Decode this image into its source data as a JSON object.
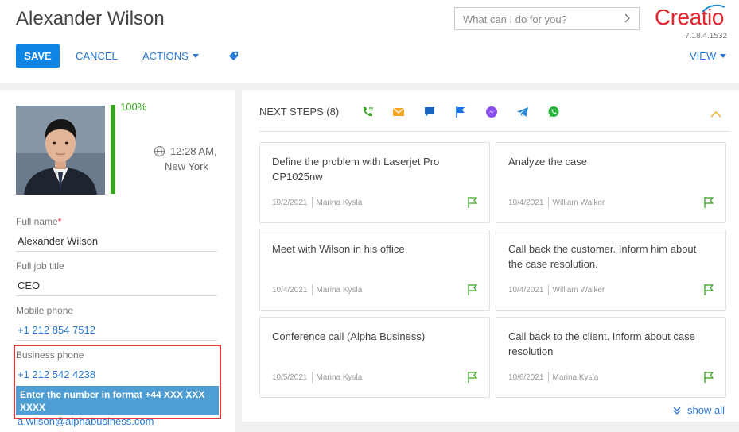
{
  "header": {
    "title": "Alexander Wilson",
    "search_placeholder": "What can I do for you?",
    "logo": "Creatio",
    "version": "7.18.4.1532",
    "save_label": "SAVE",
    "cancel_label": "CANCEL",
    "actions_label": "ACTIONS",
    "view_label": "VIEW"
  },
  "profile": {
    "completeness": "100%",
    "completeness_fraction": 1.0,
    "local_time": "12:28 AM,",
    "city": "New York"
  },
  "fields": {
    "full_name_label": "Full name",
    "full_name_required": "*",
    "full_name_value": "Alexander Wilson",
    "job_title_label": "Full job title",
    "job_title_value": "CEO",
    "mobile_label": "Mobile phone",
    "mobile_value": "+1 212 854 7512",
    "business_label": "Business phone",
    "business_value": "+1 212 542 4238",
    "business_hint": "Enter the number in format +44 XXX XXX XXXX",
    "email_value": "a.wilson@alphabusiness.com"
  },
  "next_steps": {
    "title": "NEXT STEPS (8)",
    "show_all": "show all",
    "icons": [
      "phone-call-icon",
      "email-icon",
      "chat-icon",
      "flag-icon",
      "messenger-icon",
      "telegram-icon",
      "whatsapp-icon"
    ],
    "cards": [
      {
        "title": "Define the problem with Laserjet Pro CP1025nw",
        "date": "10/2/2021",
        "owner": "Marina Kysla"
      },
      {
        "title": "Analyze the case",
        "date": "10/4/2021",
        "owner": "William Walker"
      },
      {
        "title": "Meet with Wilson in his office",
        "date": "10/4/2021",
        "owner": "Marina Kysla"
      },
      {
        "title": "Call back the customer. Inform him about the case resolution.",
        "date": "10/4/2021",
        "owner": "William Walker"
      },
      {
        "title": "Conference call (Alpha Business)",
        "date": "10/5/2021",
        "owner": "Marina Kysla"
      },
      {
        "title": "Call back to the client. Inform about case resolution",
        "date": "10/6/2021",
        "owner": "Marina Kysla"
      }
    ]
  },
  "colors": {
    "accent": "#0e84e5",
    "link": "#2a7ad6",
    "brand": "#e3262d",
    "progress": "#37a41f",
    "tooltip": "#4f9ed3",
    "highlight": "#e3363a"
  }
}
